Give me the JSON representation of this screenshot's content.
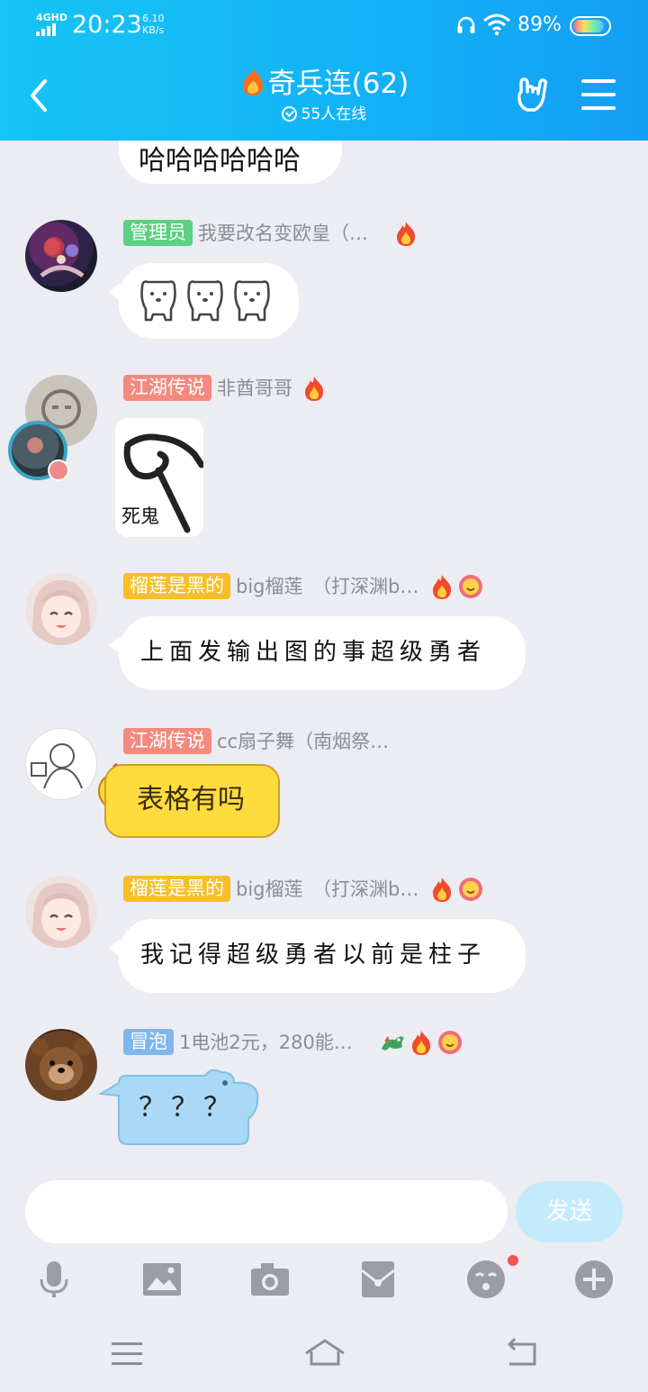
{
  "status": {
    "signal": "4GHD",
    "time": "20:23",
    "speed_value": "6.10",
    "speed_unit": "KB/s",
    "battery": "89%",
    "battery_level": 0.89
  },
  "header": {
    "title": "奇兵连(62)",
    "online": "55人在线"
  },
  "messages": [
    {
      "text": "哈哈哈哈哈哈"
    },
    {
      "badge": "管理员",
      "sender": "我要改名变欧皇（…"
    },
    {
      "badge": "江湖传说",
      "sender": "非酋哥哥",
      "sticker_text": "死鬼"
    },
    {
      "badge": "榴莲是黑的",
      "sender": "big榴莲　（打深渊b…",
      "text": "上面发输出图的事超级勇者"
    },
    {
      "badge": "江湖传说",
      "sender": "cc扇子舞（南烟祭…",
      "text": "表格有吗"
    },
    {
      "badge": "榴莲是黑的",
      "sender": "big榴莲　（打深渊b…",
      "text": "我记得超级勇者以前是柱子"
    },
    {
      "badge": "冒泡",
      "sender": "1电池2元，280能…",
      "text": "？？？"
    }
  ],
  "input": {
    "placeholder": "",
    "send_label": "发送"
  },
  "icons": {
    "back": "chevron-left-icon",
    "hand": "rock-hand-icon",
    "menu": "hamburger-menu-icon",
    "tools": [
      "microphone-icon",
      "image-icon",
      "camera-icon",
      "red-packet-icon",
      "emoji-icon",
      "plus-icon"
    ],
    "nav": [
      "menu-icon",
      "home-icon",
      "back-icon"
    ]
  },
  "colors": {
    "header_bg": "#17c4f5",
    "chat_bg": "#ececf3",
    "send_button": "#c3ebfb"
  }
}
